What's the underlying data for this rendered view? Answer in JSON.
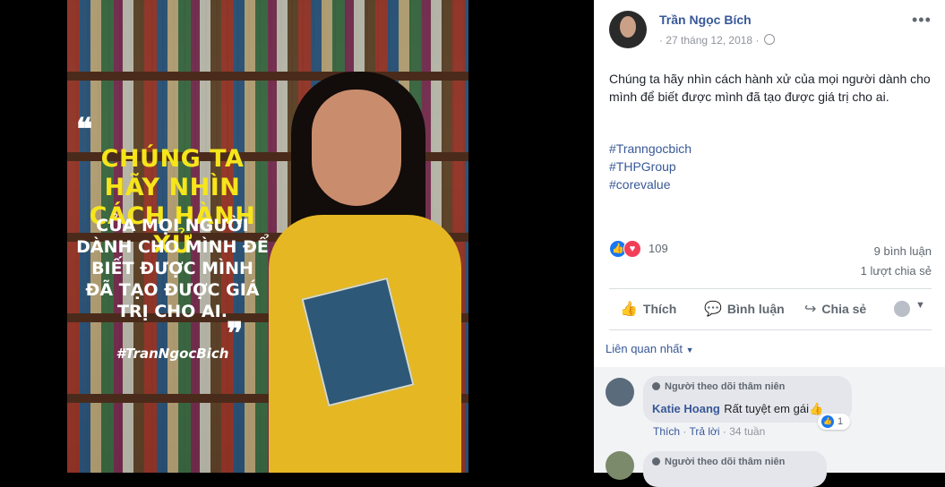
{
  "photo": {
    "quote_line1": "CHÚNG TA HÃY NHÌN CÁCH HÀNH XỬ",
    "quote_line2": "CỦA MỌI NGƯỜI DÀNH CHO MÌNH ĐỂ BIẾT ĐƯỢC MÌNH ĐÃ TẠO ĐƯỢC GIÁ TRỊ CHO AI.",
    "quote_hashtag": "#TranNgocBich"
  },
  "post": {
    "author": "Trần Ngọc Bích",
    "date": "27 tháng 12, 2018",
    "more_icon": "more-icon",
    "text": "Chúng ta hãy nhìn cách hành xử của mọi người dành cho mình để biết được mình đã tạo được giá trị cho ai.",
    "hashtags": [
      "#Tranngocbich",
      "#THPGroup",
      "#corevalue"
    ],
    "reaction_count": "109",
    "comments_count": "9 bình luận",
    "shares_count": "1 lượt chia sẻ"
  },
  "actions": {
    "like": "Thích",
    "comment": "Bình luận",
    "share": "Chia sẻ"
  },
  "comments_filter": "Liên quan nhất",
  "comments": [
    {
      "badge": "Người theo dõi thâm niên",
      "name": "Katie Hoang",
      "text": "Rất tuyệt em gái👍",
      "likes": "1",
      "like_label": "Thích",
      "reply_label": "Trả lời",
      "time": "34 tuần"
    },
    {
      "badge": "Người theo dõi thâm niên"
    }
  ],
  "colors": {
    "link": "#385898",
    "quote_yellow": "#f6e51a",
    "dress_yellow": "#e5b823"
  }
}
